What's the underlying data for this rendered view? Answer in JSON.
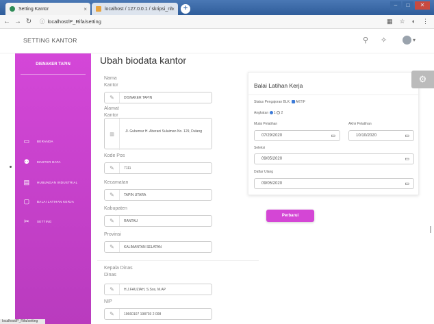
{
  "browser": {
    "tabs": [
      {
        "title": "Setting Kantor"
      },
      {
        "title": "localhost / 127.0.0.1 / skripsi_nh"
      }
    ],
    "url": "localhost/P_Rifa/setting",
    "new_tab": "+",
    "window_buttons": [
      "–",
      "□",
      "✕"
    ],
    "tab_close": "×",
    "status_bar": "localhost/P_Rifa/setting"
  },
  "topnav": {
    "title": "SETTING KANTOR"
  },
  "sidebar": {
    "brand": "DISNAKER TAPIN",
    "items": [
      {
        "label": "BERANDA",
        "icon": "monitor-icon"
      },
      {
        "label": "MASTER DATA",
        "icon": "users-icon"
      },
      {
        "label": "HUBUNGAN INDUSTRIAL",
        "icon": "document-icon"
      },
      {
        "label": "BALAI LATIHAN KERJA",
        "icon": "chat-icon"
      },
      {
        "label": "SETTING",
        "icon": "tools-icon"
      }
    ]
  },
  "main": {
    "title": "Ubah biodata kantor",
    "fields": {
      "nama_kantor": {
        "label": "Nama Kantor",
        "value": "DISNAKER TAPIN"
      },
      "alamat_kantor": {
        "label": "Alamat Kantor",
        "value": "Jl. Gubernur H. Aberani Sulaiman No. 129, Dulang"
      },
      "kode_pos": {
        "label": "Kode Pos",
        "value": "7111"
      },
      "kecamatan": {
        "label": "Kecamatan",
        "value": "TAPIN UTARA"
      },
      "kabupaten": {
        "label": "Kabupaten",
        "value": "RANTAU"
      },
      "provinsi": {
        "label": "Provinsi",
        "value": "KALIMANTAN SELATAN"
      },
      "kepala_dinas": {
        "label": "Kepala Dinas Dinas",
        "value": "H.J.FAUZIAH, S.Sos, M.AP"
      },
      "nip": {
        "label": "NIP",
        "value": "19660107 198703 2 008"
      }
    }
  },
  "card": {
    "title": "Balai Latihan Kerja",
    "status_label": "Status Pengajoran BLK:",
    "status_value": "AKTIF",
    "angkatan_label": "Angkatan",
    "angkatan_options": [
      "1",
      "2"
    ],
    "mulai_label": "Mulai Pelatihan",
    "mulai_value": "07/29/2020",
    "akhir_label": "Akhir Pelatihan",
    "akhir_value": "10/10/2020",
    "seleksi_label": "Seleksi",
    "seleksi_value": "09/05/2020",
    "daftar_label": "Daftar Ulang",
    "daftar_value": "09/05/2020",
    "submit_label": "Perbarui"
  },
  "colors": {
    "sidebar": "#d447d8",
    "accent": "#d446d5",
    "checkbox": "#3d7bd8"
  }
}
